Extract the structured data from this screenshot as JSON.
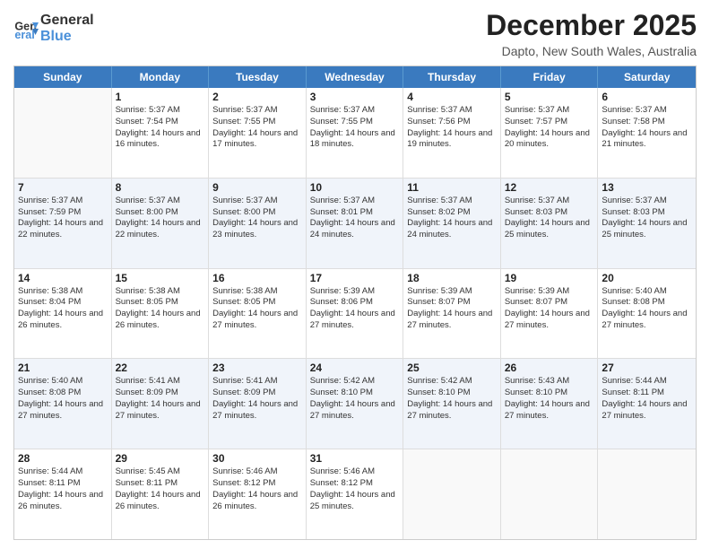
{
  "header": {
    "logo_line1": "General",
    "logo_line2": "Blue",
    "title": "December 2025",
    "subtitle": "Dapto, New South Wales, Australia"
  },
  "calendar": {
    "days_of_week": [
      "Sunday",
      "Monday",
      "Tuesday",
      "Wednesday",
      "Thursday",
      "Friday",
      "Saturday"
    ],
    "weeks": [
      [
        {
          "day": "",
          "info": ""
        },
        {
          "day": "1",
          "info": "Sunrise: 5:37 AM\nSunset: 7:54 PM\nDaylight: 14 hours\nand 16 minutes."
        },
        {
          "day": "2",
          "info": "Sunrise: 5:37 AM\nSunset: 7:55 PM\nDaylight: 14 hours\nand 17 minutes."
        },
        {
          "day": "3",
          "info": "Sunrise: 5:37 AM\nSunset: 7:55 PM\nDaylight: 14 hours\nand 18 minutes."
        },
        {
          "day": "4",
          "info": "Sunrise: 5:37 AM\nSunset: 7:56 PM\nDaylight: 14 hours\nand 19 minutes."
        },
        {
          "day": "5",
          "info": "Sunrise: 5:37 AM\nSunset: 7:57 PM\nDaylight: 14 hours\nand 20 minutes."
        },
        {
          "day": "6",
          "info": "Sunrise: 5:37 AM\nSunset: 7:58 PM\nDaylight: 14 hours\nand 21 minutes."
        }
      ],
      [
        {
          "day": "7",
          "info": "Sunrise: 5:37 AM\nSunset: 7:59 PM\nDaylight: 14 hours\nand 22 minutes."
        },
        {
          "day": "8",
          "info": "Sunrise: 5:37 AM\nSunset: 8:00 PM\nDaylight: 14 hours\nand 22 minutes."
        },
        {
          "day": "9",
          "info": "Sunrise: 5:37 AM\nSunset: 8:00 PM\nDaylight: 14 hours\nand 23 minutes."
        },
        {
          "day": "10",
          "info": "Sunrise: 5:37 AM\nSunset: 8:01 PM\nDaylight: 14 hours\nand 24 minutes."
        },
        {
          "day": "11",
          "info": "Sunrise: 5:37 AM\nSunset: 8:02 PM\nDaylight: 14 hours\nand 24 minutes."
        },
        {
          "day": "12",
          "info": "Sunrise: 5:37 AM\nSunset: 8:03 PM\nDaylight: 14 hours\nand 25 minutes."
        },
        {
          "day": "13",
          "info": "Sunrise: 5:37 AM\nSunset: 8:03 PM\nDaylight: 14 hours\nand 25 minutes."
        }
      ],
      [
        {
          "day": "14",
          "info": "Sunrise: 5:38 AM\nSunset: 8:04 PM\nDaylight: 14 hours\nand 26 minutes."
        },
        {
          "day": "15",
          "info": "Sunrise: 5:38 AM\nSunset: 8:05 PM\nDaylight: 14 hours\nand 26 minutes."
        },
        {
          "day": "16",
          "info": "Sunrise: 5:38 AM\nSunset: 8:05 PM\nDaylight: 14 hours\nand 27 minutes."
        },
        {
          "day": "17",
          "info": "Sunrise: 5:39 AM\nSunset: 8:06 PM\nDaylight: 14 hours\nand 27 minutes."
        },
        {
          "day": "18",
          "info": "Sunrise: 5:39 AM\nSunset: 8:07 PM\nDaylight: 14 hours\nand 27 minutes."
        },
        {
          "day": "19",
          "info": "Sunrise: 5:39 AM\nSunset: 8:07 PM\nDaylight: 14 hours\nand 27 minutes."
        },
        {
          "day": "20",
          "info": "Sunrise: 5:40 AM\nSunset: 8:08 PM\nDaylight: 14 hours\nand 27 minutes."
        }
      ],
      [
        {
          "day": "21",
          "info": "Sunrise: 5:40 AM\nSunset: 8:08 PM\nDaylight: 14 hours\nand 27 minutes."
        },
        {
          "day": "22",
          "info": "Sunrise: 5:41 AM\nSunset: 8:09 PM\nDaylight: 14 hours\nand 27 minutes."
        },
        {
          "day": "23",
          "info": "Sunrise: 5:41 AM\nSunset: 8:09 PM\nDaylight: 14 hours\nand 27 minutes."
        },
        {
          "day": "24",
          "info": "Sunrise: 5:42 AM\nSunset: 8:10 PM\nDaylight: 14 hours\nand 27 minutes."
        },
        {
          "day": "25",
          "info": "Sunrise: 5:42 AM\nSunset: 8:10 PM\nDaylight: 14 hours\nand 27 minutes."
        },
        {
          "day": "26",
          "info": "Sunrise: 5:43 AM\nSunset: 8:10 PM\nDaylight: 14 hours\nand 27 minutes."
        },
        {
          "day": "27",
          "info": "Sunrise: 5:44 AM\nSunset: 8:11 PM\nDaylight: 14 hours\nand 27 minutes."
        }
      ],
      [
        {
          "day": "28",
          "info": "Sunrise: 5:44 AM\nSunset: 8:11 PM\nDaylight: 14 hours\nand 26 minutes."
        },
        {
          "day": "29",
          "info": "Sunrise: 5:45 AM\nSunset: 8:11 PM\nDaylight: 14 hours\nand 26 minutes."
        },
        {
          "day": "30",
          "info": "Sunrise: 5:46 AM\nSunset: 8:12 PM\nDaylight: 14 hours\nand 26 minutes."
        },
        {
          "day": "31",
          "info": "Sunrise: 5:46 AM\nSunset: 8:12 PM\nDaylight: 14 hours\nand 25 minutes."
        },
        {
          "day": "",
          "info": ""
        },
        {
          "day": "",
          "info": ""
        },
        {
          "day": "",
          "info": ""
        }
      ]
    ]
  }
}
